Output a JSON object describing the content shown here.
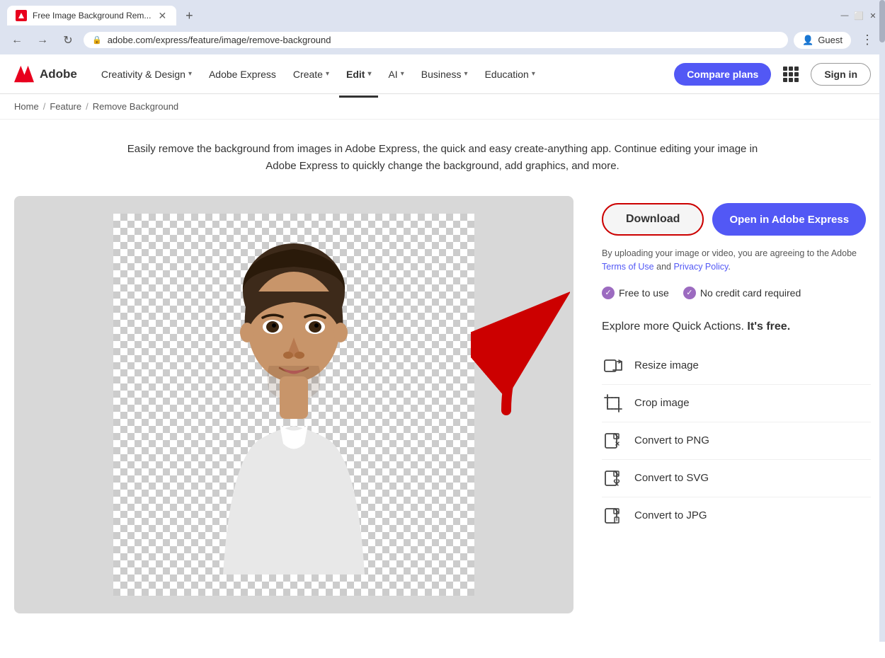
{
  "browser": {
    "tab_label": "Free Image Background Rem...",
    "url": "adobe.com/express/feature/image/remove-background",
    "new_tab_icon": "+",
    "profile_label": "Guest",
    "minimize": "—",
    "maximize": "⬜",
    "close": "✕",
    "back": "←",
    "forward": "→",
    "reload": "↻",
    "menu": "⋮"
  },
  "nav": {
    "logo_text": "Adobe",
    "items": [
      {
        "label": "Creativity & Design",
        "has_dropdown": true,
        "active": false
      },
      {
        "label": "Adobe Express",
        "has_dropdown": false,
        "active": false
      },
      {
        "label": "Create",
        "has_dropdown": true,
        "active": false
      },
      {
        "label": "Edit",
        "has_dropdown": true,
        "active": true
      },
      {
        "label": "AI",
        "has_dropdown": true,
        "active": false
      },
      {
        "label": "Business",
        "has_dropdown": true,
        "active": false
      },
      {
        "label": "Education",
        "has_dropdown": true,
        "active": false
      }
    ],
    "compare_plans": "Compare plans",
    "sign_in": "Sign in"
  },
  "breadcrumb": {
    "home": "Home",
    "feature": "Feature",
    "current": "Remove Background"
  },
  "hero": {
    "text": "Easily remove the background from images in Adobe Express, the quick and easy create-anything app. Continue editing your image in Adobe Express to quickly change the background, add graphics, and more."
  },
  "actions": {
    "download": "Download",
    "open_express": "Open in Adobe Express",
    "upload_agreement": "By uploading your image or video, you are agreeing to the Adobe",
    "terms_of_use": "Terms of Use",
    "and": "and",
    "privacy_policy": "Privacy Policy",
    "period": "."
  },
  "badges": [
    {
      "label": "Free to use"
    },
    {
      "label": "No credit card required"
    }
  ],
  "quick_actions": {
    "title_start": "Explore more Quick Actions.",
    "title_bold": "It's free.",
    "items": [
      {
        "label": "Resize image",
        "icon": "resize"
      },
      {
        "label": "Crop image",
        "icon": "crop"
      },
      {
        "label": "Convert to PNG",
        "icon": "convert-png"
      },
      {
        "label": "Convert to SVG",
        "icon": "convert-svg"
      },
      {
        "label": "Convert to JPG",
        "icon": "convert-jpg"
      }
    ]
  },
  "page_title": "Image Background"
}
